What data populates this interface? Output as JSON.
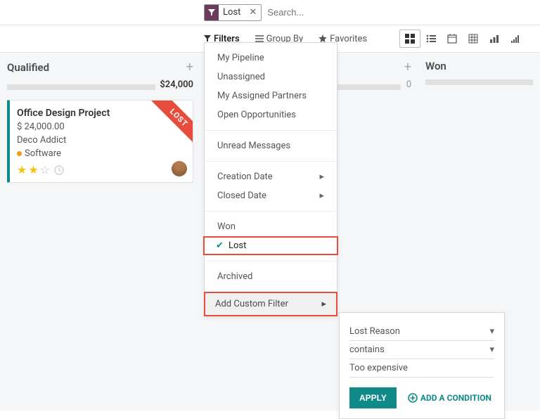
{
  "search": {
    "tag_label": "Lost",
    "placeholder": "Search..."
  },
  "toolbar": {
    "filters": "Filters",
    "group_by": "Group By",
    "favorites": "Favorites"
  },
  "kanban": {
    "stages": [
      {
        "title": "Qualified",
        "sum": "$24,000"
      },
      {
        "title": "",
        "sum": "0"
      },
      {
        "title": "Won",
        "sum": ""
      }
    ]
  },
  "card": {
    "title": "Office Design Project",
    "amount": "$ 24,000.00",
    "customer": "Deco Addict",
    "tag": "Software",
    "ribbon": "LOST",
    "stars": 2
  },
  "filters_menu": {
    "section1": [
      "My Pipeline",
      "Unassigned",
      "My Assigned Partners",
      "Open Opportunities"
    ],
    "section2": [
      "Unread Messages"
    ],
    "section3": [
      "Creation Date",
      "Closed Date"
    ],
    "section4": [
      "Won",
      "Lost"
    ],
    "section5": [
      "Archived"
    ],
    "add": "Add Custom Filter",
    "checked": "Lost"
  },
  "custom_filter": {
    "field": "Lost Reason",
    "operator": "contains",
    "value": "Too expensive",
    "apply": "APPLY",
    "add_condition": "ADD A CONDITION"
  }
}
